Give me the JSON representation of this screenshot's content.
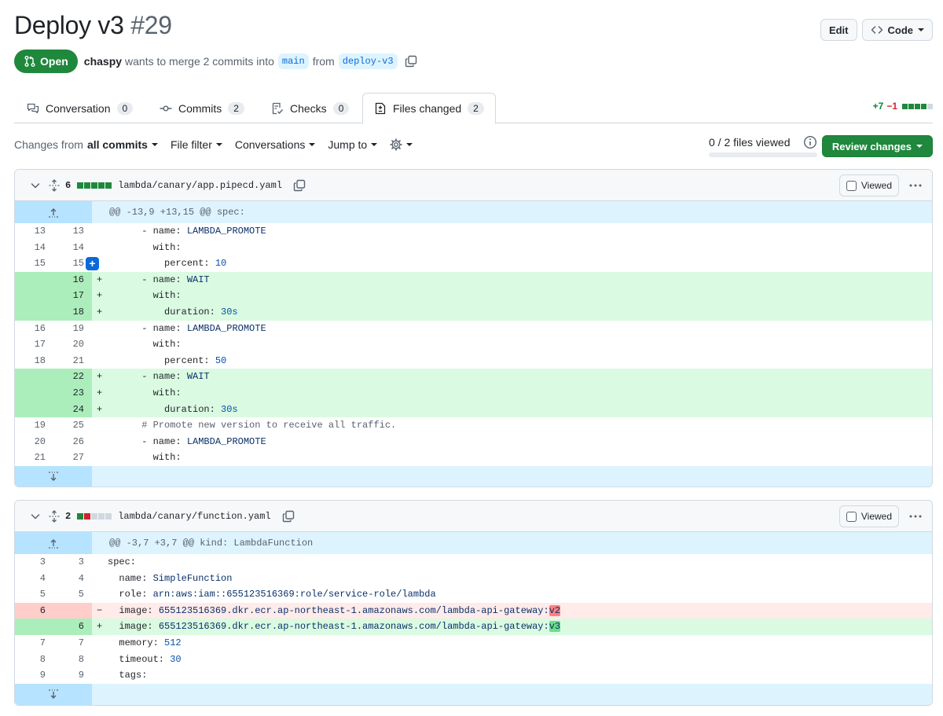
{
  "pr": {
    "title": "Deploy v3",
    "number": "#29",
    "state": "Open",
    "author": "chaspy",
    "merge_text": "wants to merge 2 commits into",
    "base_branch": "main",
    "from_text": "from",
    "head_branch": "deploy-v3"
  },
  "header_buttons": {
    "edit": "Edit",
    "code": "Code"
  },
  "tabs": [
    {
      "label": "Conversation",
      "count": "0"
    },
    {
      "label": "Commits",
      "count": "2"
    },
    {
      "label": "Checks",
      "count": "0"
    },
    {
      "label": "Files changed",
      "count": "2"
    }
  ],
  "diffstat": {
    "additions": "+7",
    "deletions": "−1"
  },
  "toolbar": {
    "changes_from_prefix": "Changes from",
    "changes_from_value": "all commits",
    "file_filter": "File filter",
    "conversations": "Conversations",
    "jump_to": "Jump to",
    "files_viewed": "0 / 2 files viewed",
    "review_changes": "Review changes"
  },
  "files": [
    {
      "count": "6",
      "name": "lambda/canary/app.pipecd.yaml",
      "viewed_label": "Viewed",
      "hunk": "@@ -13,9 +13,15 @@ spec:"
    },
    {
      "count": "2",
      "name": "lambda/canary/function.yaml",
      "viewed_label": "Viewed",
      "hunk": "@@ -3,7 +3,7 @@ kind: LambdaFunction"
    }
  ],
  "colors": {
    "accent": "#1f883d",
    "add_bg": "#dafbe1",
    "del_bg": "#ffebe9",
    "hunk_bg": "#ddf4ff"
  }
}
